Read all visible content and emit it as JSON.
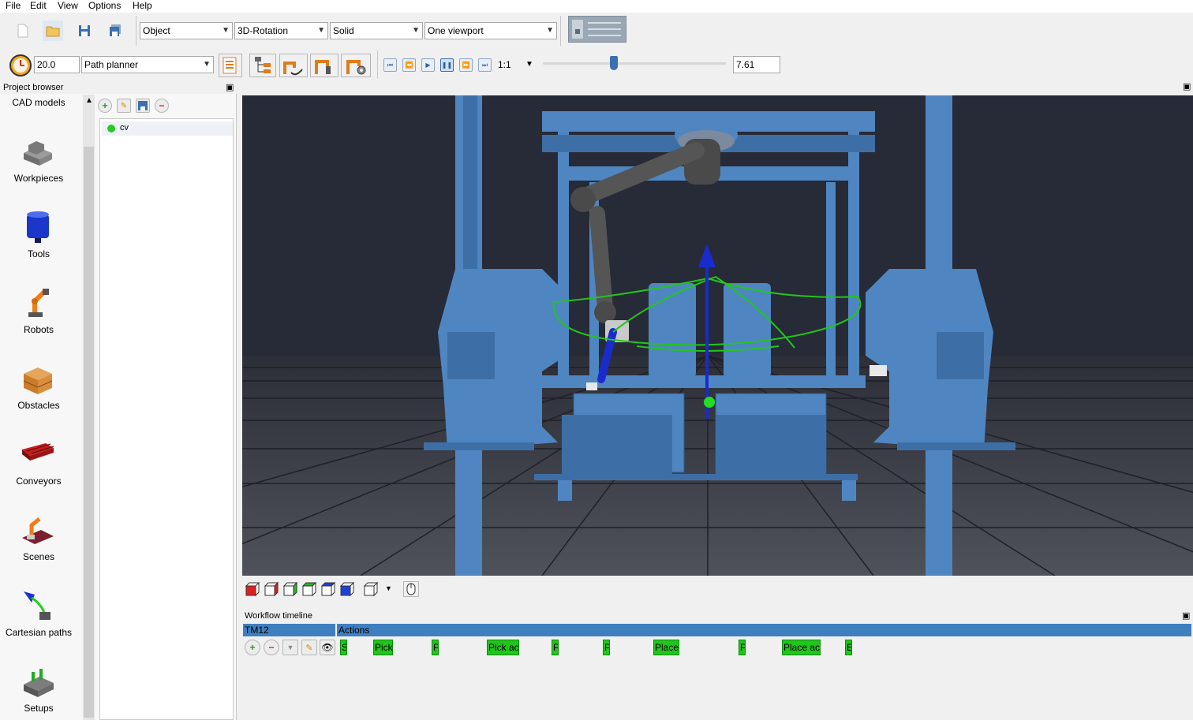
{
  "menu": [
    "File",
    "Edit",
    "View",
    "Options",
    "Help"
  ],
  "toolbar": {
    "mode_select": "Object",
    "rotation_select": "3D-Rotation",
    "render_select": "Solid",
    "viewport_select": "One viewport",
    "time_value": "20.0",
    "planner_select": "Path planner",
    "speed_select": "1:1",
    "sim_time": "7.61",
    "slider_level": 0.39
  },
  "left_panel": {
    "title": "Project browser",
    "categories": [
      {
        "label": "CAD models",
        "icon": "cad-models-icon"
      },
      {
        "label": "Workpieces",
        "icon": "workpiece-icon"
      },
      {
        "label": "Tools",
        "icon": "tool-icon"
      },
      {
        "label": "Robots",
        "icon": "robot-icon"
      },
      {
        "label": "Obstacles",
        "icon": "obstacle-icon"
      },
      {
        "label": "Conveyors",
        "icon": "conveyor-icon"
      },
      {
        "label": "Scenes",
        "icon": "scene-icon"
      },
      {
        "label": "Cartesian paths",
        "icon": "cartesian-path-icon"
      },
      {
        "label": "Setups",
        "icon": "setup-icon"
      }
    ],
    "tree_items": [
      {
        "label": "cv",
        "status_color": "#22cc22"
      }
    ]
  },
  "timeline": {
    "title": "Workflow timeline",
    "robot": "TM12",
    "actions_header": "Actions",
    "actions": [
      "S",
      "Pick",
      "P",
      "Pick ac",
      "P",
      "P",
      "Place",
      "P",
      "Place act",
      "E"
    ]
  },
  "colors": {
    "structure_blue": "#4f86c2",
    "viewport_bg": "#272a37",
    "action_green": "#22c51c",
    "header_blue": "#3f7fbf"
  }
}
